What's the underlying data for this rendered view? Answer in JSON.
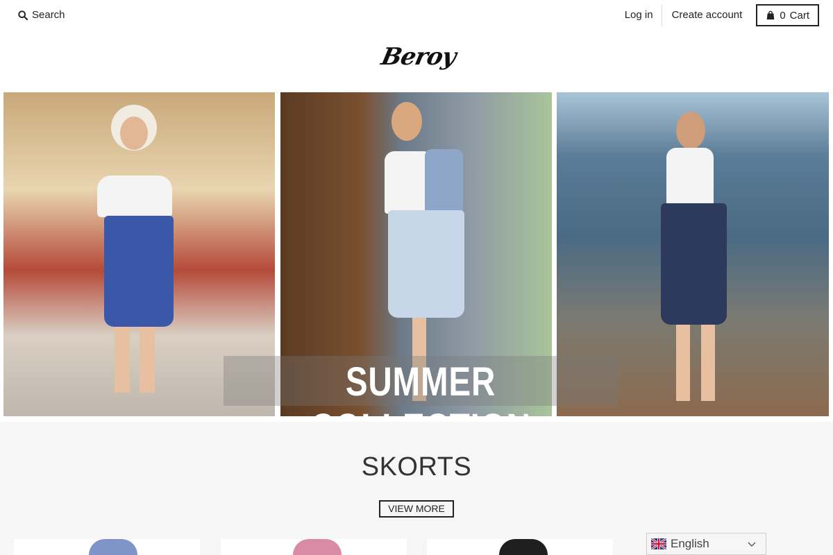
{
  "header": {
    "search_label": "Search",
    "login_label": "Log in",
    "create_account_label": "Create account",
    "cart_count": "0",
    "cart_label": "Cart"
  },
  "logo": {
    "text": "Beroy"
  },
  "hero": {
    "title": "SUMMER COLLECTION"
  },
  "collection": {
    "title": "SKORTS",
    "view_more_label": "VIEW MORE"
  },
  "language": {
    "selected": "English"
  },
  "icons": {
    "search": "search-icon",
    "cart": "shopping-bag-icon",
    "flag": "uk-flag-icon",
    "dropdown": "chevron-down-icon"
  },
  "colors": {
    "text": "#222222",
    "section_bg": "#f6f6f6",
    "hero_text": "#ffffff"
  }
}
